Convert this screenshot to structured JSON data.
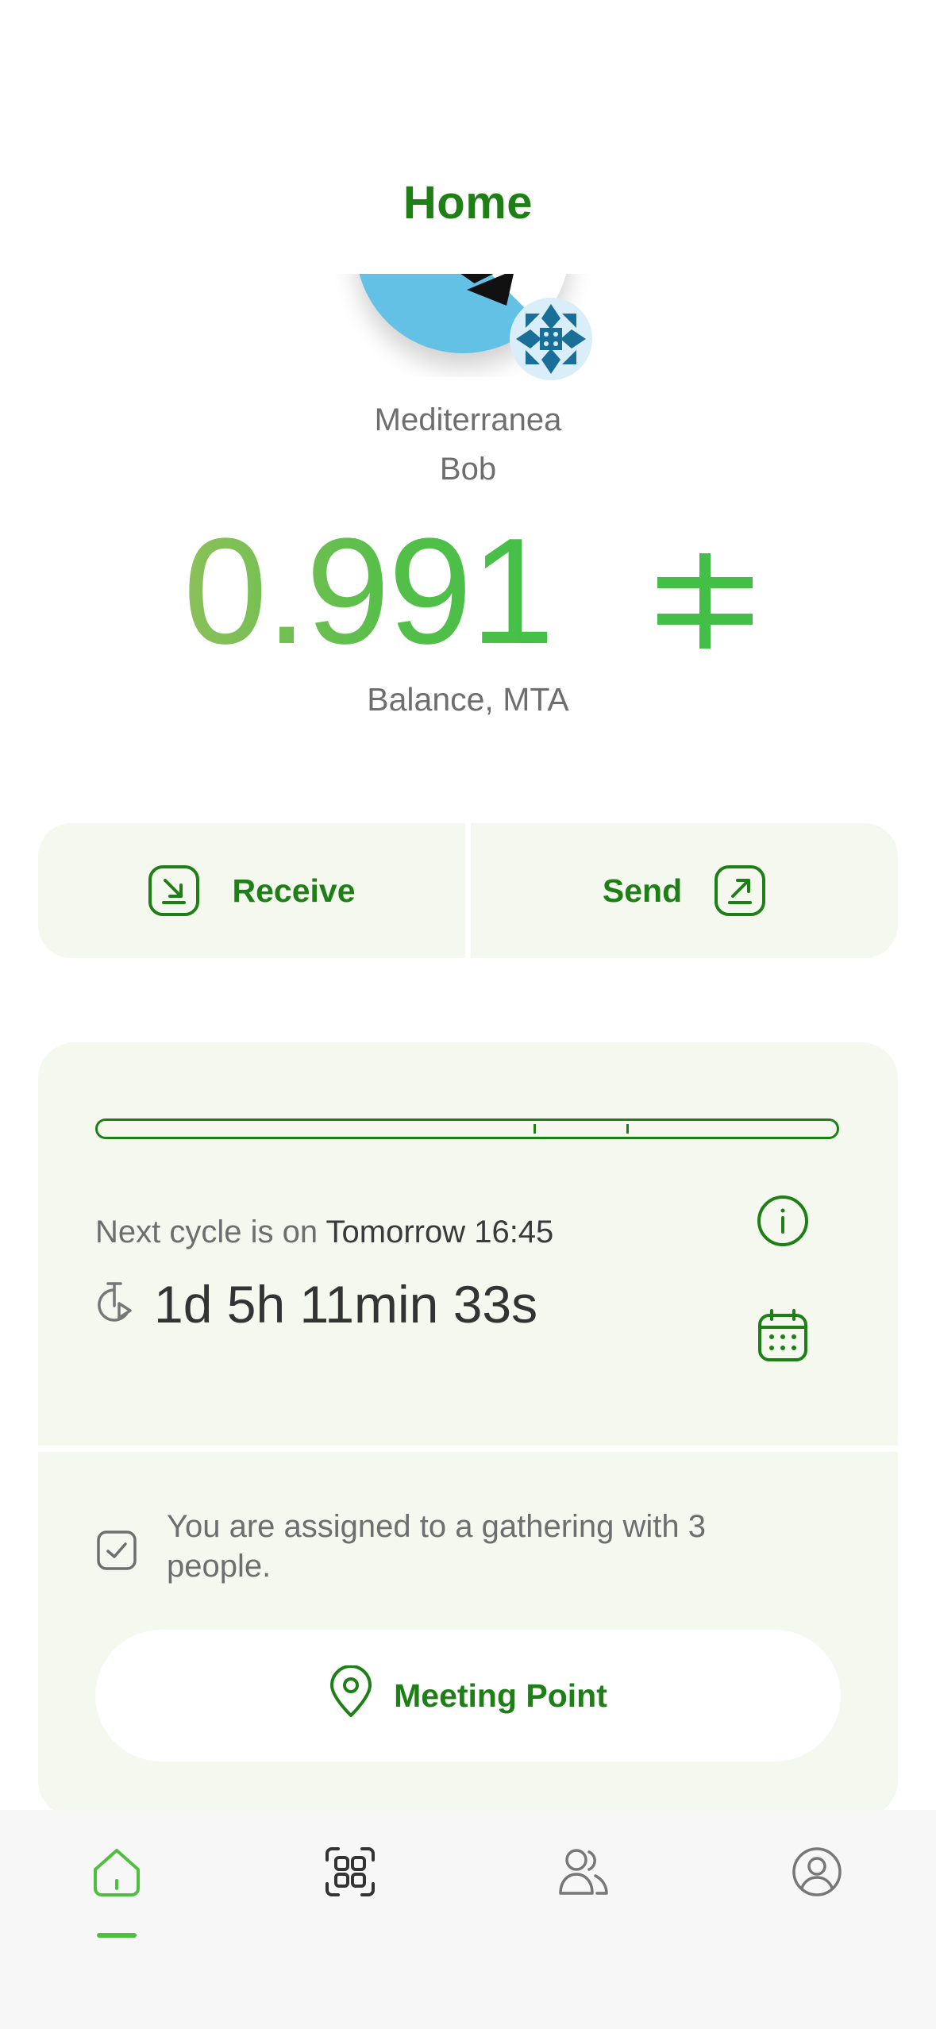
{
  "header": {
    "title": "Home"
  },
  "profile": {
    "community_name": "Mediterranea",
    "user_name": "Bob",
    "avatar_icon": "community-flag-avatar",
    "badge_icon": "pattern-badge-icon"
  },
  "balance": {
    "amount": "0.991",
    "currency_symbol": "ⵜ",
    "label": "Balance, MTA"
  },
  "actions": {
    "receive_label": "Receive",
    "send_label": "Send"
  },
  "cycle": {
    "progress_ticks_fraction": [
      0.59,
      0.715
    ],
    "next_cycle_prefix": "Next cycle is on ",
    "next_cycle_value": "Tomorrow 16:45",
    "countdown": "1d 5h 11min 33s"
  },
  "gathering": {
    "text": "You are assigned to a gathering with 3 people.",
    "meeting_point_label": "Meeting Point"
  },
  "tabbar": {
    "items": [
      {
        "name": "home",
        "active": true
      },
      {
        "name": "scan",
        "active": false
      },
      {
        "name": "contacts",
        "active": false
      },
      {
        "name": "profile",
        "active": false
      }
    ]
  },
  "colors": {
    "accent": "#1e7f16",
    "balance_green": "#52bf48",
    "card_bg": "#f4f8ee",
    "avatar_blue": "#64c1e6"
  }
}
